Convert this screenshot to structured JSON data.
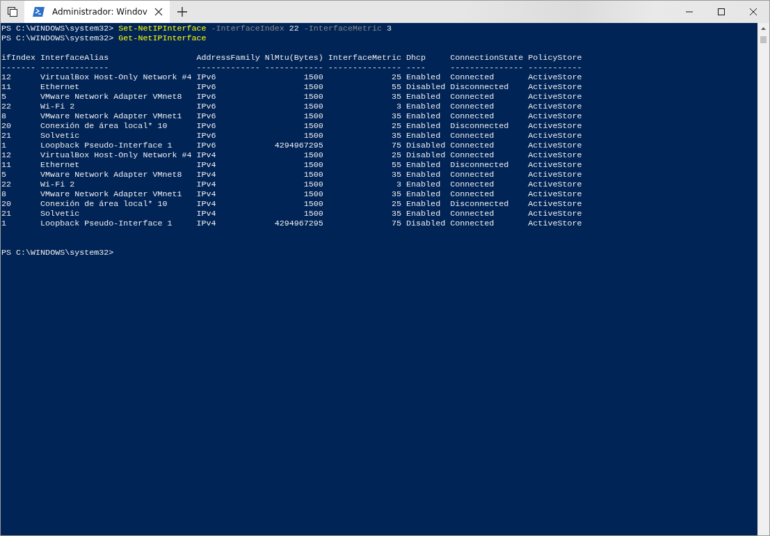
{
  "tabs": [
    {
      "title": "Administrador: Windov",
      "selected": true
    }
  ],
  "console": {
    "commands": [
      {
        "prompt": "PS C:\\WINDOWS\\system32>",
        "tokens": [
          {
            "text": "Set-NetIPInterface",
            "kind": "command"
          },
          {
            "text": "-InterfaceIndex",
            "kind": "parameter"
          },
          {
            "text": "22",
            "kind": "value"
          },
          {
            "text": "-InterfaceMetric",
            "kind": "parameter"
          },
          {
            "text": "3",
            "kind": "value"
          }
        ]
      },
      {
        "prompt": "PS C:\\WINDOWS\\system32>",
        "tokens": [
          {
            "text": "Get-NetIPInterface",
            "kind": "command"
          }
        ]
      }
    ],
    "table": {
      "columns": [
        {
          "header": "ifIndex",
          "rule": "-------",
          "kind": "text"
        },
        {
          "header": "InterfaceAlias",
          "rule": "--------------",
          "kind": "text"
        },
        {
          "header": "AddressFamily",
          "rule": "-------------",
          "kind": "text"
        },
        {
          "header": "NlMtu(Bytes)",
          "rule": "------------",
          "kind": "number"
        },
        {
          "header": "InterfaceMetric",
          "rule": "---------------",
          "kind": "number"
        },
        {
          "header": "Dhcp",
          "rule": "----",
          "kind": "text"
        },
        {
          "header": "ConnectionState",
          "rule": "---------------",
          "kind": "text"
        },
        {
          "header": "PolicyStore",
          "rule": "-----------",
          "kind": "text"
        }
      ],
      "rows": [
        [
          "12",
          "VirtualBox Host-Only Network #4",
          "IPv6",
          "1500",
          "25",
          "Enabled",
          "Connected",
          "ActiveStore"
        ],
        [
          "11",
          "Ethernet",
          "IPv6",
          "1500",
          "55",
          "Disabled",
          "Disconnected",
          "ActiveStore"
        ],
        [
          "5",
          "VMware Network Adapter VMnet8",
          "IPv6",
          "1500",
          "35",
          "Enabled",
          "Connected",
          "ActiveStore"
        ],
        [
          "22",
          "Wi-Fi 2",
          "IPv6",
          "1500",
          "3",
          "Enabled",
          "Connected",
          "ActiveStore"
        ],
        [
          "8",
          "VMware Network Adapter VMnet1",
          "IPv6",
          "1500",
          "35",
          "Enabled",
          "Connected",
          "ActiveStore"
        ],
        [
          "20",
          "Conexión de área local* 10",
          "IPv6",
          "1500",
          "25",
          "Enabled",
          "Disconnected",
          "ActiveStore"
        ],
        [
          "21",
          "Solvetic",
          "IPv6",
          "1500",
          "35",
          "Enabled",
          "Connected",
          "ActiveStore"
        ],
        [
          "1",
          "Loopback Pseudo-Interface 1",
          "IPv6",
          "4294967295",
          "75",
          "Disabled",
          "Connected",
          "ActiveStore"
        ],
        [
          "12",
          "VirtualBox Host-Only Network #4",
          "IPv4",
          "1500",
          "25",
          "Disabled",
          "Connected",
          "ActiveStore"
        ],
        [
          "11",
          "Ethernet",
          "IPv4",
          "1500",
          "55",
          "Enabled",
          "Disconnected",
          "ActiveStore"
        ],
        [
          "5",
          "VMware Network Adapter VMnet8",
          "IPv4",
          "1500",
          "35",
          "Enabled",
          "Connected",
          "ActiveStore"
        ],
        [
          "22",
          "Wi-Fi 2",
          "IPv4",
          "1500",
          "3",
          "Enabled",
          "Connected",
          "ActiveStore"
        ],
        [
          "8",
          "VMware Network Adapter VMnet1",
          "IPv4",
          "1500",
          "35",
          "Enabled",
          "Connected",
          "ActiveStore"
        ],
        [
          "20",
          "Conexión de área local* 10",
          "IPv4",
          "1500",
          "25",
          "Enabled",
          "Disconnected",
          "ActiveStore"
        ],
        [
          "21",
          "Solvetic",
          "IPv4",
          "1500",
          "35",
          "Enabled",
          "Connected",
          "ActiveStore"
        ],
        [
          "1",
          "Loopback Pseudo-Interface 1",
          "IPv4",
          "4294967295",
          "75",
          "Disabled",
          "Connected",
          "ActiveStore"
        ]
      ]
    },
    "final_prompt": "PS C:\\WINDOWS\\system32>"
  }
}
